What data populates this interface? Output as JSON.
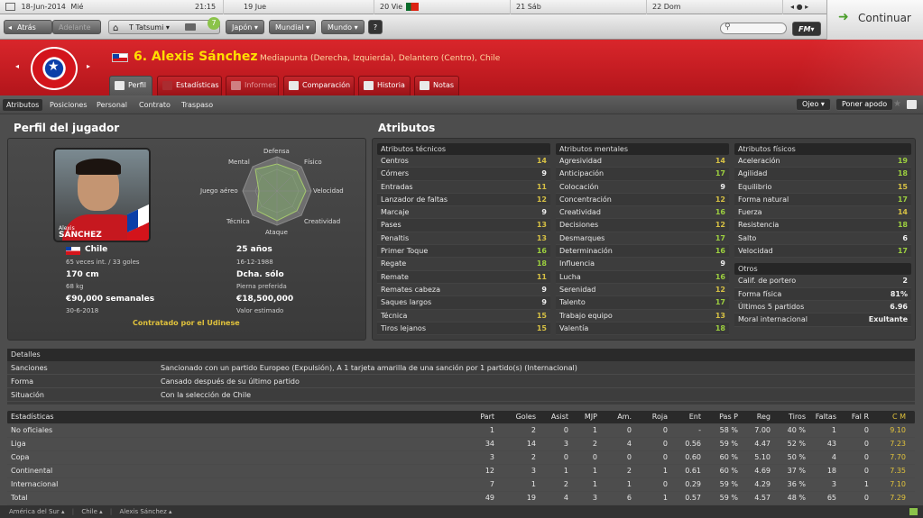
{
  "topstrip": {
    "date": "18-Jun-2014",
    "day": "Mié",
    "time": "21:15",
    "cal": [
      {
        "label": "19 Jue"
      },
      {
        "label": "20 Vie"
      },
      {
        "label": "21 Sáb"
      },
      {
        "label": "22 Dom"
      }
    ]
  },
  "nav": {
    "back": "Atrás",
    "forward": "Adelante",
    "team": "T Tatsumi",
    "japan": "Japón",
    "mundial": "Mundial",
    "mundo": "Mundo",
    "help": "?",
    "badge": "7",
    "fm": "FM",
    "continue": "Continuar"
  },
  "player": {
    "title": "6. Alexis Sánchez",
    "positions": "Mediapunta (Derecha, Izquierda), Delantero (Centro), Chile"
  },
  "tabs": [
    {
      "label": "Perfil"
    },
    {
      "label": "Estadísticas"
    },
    {
      "label": "Informes"
    },
    {
      "label": "Comparación"
    },
    {
      "label": "Historia"
    },
    {
      "label": "Notas"
    }
  ],
  "subnav": {
    "items": [
      {
        "label": "Atributos"
      },
      {
        "label": "Posiciones"
      },
      {
        "label": "Personal"
      },
      {
        "label": "Contrato"
      },
      {
        "label": "Traspaso"
      }
    ],
    "ojeo": "Ojeo",
    "poner_apodo": "Poner apodo"
  },
  "profile": {
    "heading": "Perfil del jugador",
    "radar": {
      "defensa": "Defensa",
      "fisico": "Físico",
      "velocidad": "Velocidad",
      "creatividad": "Creatividad",
      "ataque": "Ataque",
      "tecnica": "Técnica",
      "juego_aereo": "Juego aéreo",
      "mental": "Mental"
    },
    "photo_first": "Alexis",
    "photo_last": "SÁNCHEZ",
    "nation": "Chile",
    "caps": "65 veces int. / 33 goles",
    "age": "25 años",
    "dob": "16-12-1988",
    "height": "170 cm",
    "weight": "68 kg",
    "foot": "Dcha. sólo",
    "foot_label": "Pierna preferida",
    "wage": "€90,000 semanales",
    "contract_end": "30-6-2018",
    "value": "€18,500,000",
    "value_label": "Valor estimado",
    "status": "Contratado por el Udinese"
  },
  "attributes": {
    "heading": "Atributos",
    "technical": {
      "title": "Atributos técnicos",
      "rows": [
        {
          "name": "Centros",
          "value": "14"
        },
        {
          "name": "Córners",
          "value": "9"
        },
        {
          "name": "Entradas",
          "value": "11"
        },
        {
          "name": "Lanzador de faltas",
          "value": "12"
        },
        {
          "name": "Marcaje",
          "value": "9"
        },
        {
          "name": "Pases",
          "value": "13"
        },
        {
          "name": "Penaltis",
          "value": "13"
        },
        {
          "name": "Primer Toque",
          "value": "16"
        },
        {
          "name": "Regate",
          "value": "18"
        },
        {
          "name": "Remate",
          "value": "11"
        },
        {
          "name": "Remates cabeza",
          "value": "9"
        },
        {
          "name": "Saques largos",
          "value": "9"
        },
        {
          "name": "Técnica",
          "value": "15"
        },
        {
          "name": "Tiros lejanos",
          "value": "15"
        }
      ]
    },
    "mental": {
      "title": "Atributos mentales",
      "rows": [
        {
          "name": "Agresividad",
          "value": "14"
        },
        {
          "name": "Anticipación",
          "value": "17"
        },
        {
          "name": "Colocación",
          "value": "9"
        },
        {
          "name": "Concentración",
          "value": "12"
        },
        {
          "name": "Creatividad",
          "value": "16"
        },
        {
          "name": "Decisiones",
          "value": "12"
        },
        {
          "name": "Desmarques",
          "value": "17"
        },
        {
          "name": "Determinación",
          "value": "16"
        },
        {
          "name": "Influencia",
          "value": "9"
        },
        {
          "name": "Lucha",
          "value": "16"
        },
        {
          "name": "Serenidad",
          "value": "12"
        },
        {
          "name": "Talento",
          "value": "17"
        },
        {
          "name": "Trabajo equipo",
          "value": "13"
        },
        {
          "name": "Valentía",
          "value": "18"
        }
      ]
    },
    "physical": {
      "title": "Atributos físicos",
      "rows": [
        {
          "name": "Aceleración",
          "value": "19"
        },
        {
          "name": "Agilidad",
          "value": "18"
        },
        {
          "name": "Equilibrio",
          "value": "15"
        },
        {
          "name": "Forma natural",
          "value": "17"
        },
        {
          "name": "Fuerza",
          "value": "14"
        },
        {
          "name": "Resistencia",
          "value": "18"
        },
        {
          "name": "Salto",
          "value": "6"
        },
        {
          "name": "Velocidad",
          "value": "17"
        }
      ]
    },
    "other": {
      "title": "Otros",
      "rows": [
        {
          "name": "Calif. de portero",
          "value": "2"
        },
        {
          "name": "Forma física",
          "value": "81%"
        },
        {
          "name": "Últimos 5 partidos",
          "value": "6.96"
        },
        {
          "name": "Moral internacional",
          "value": "Exultante"
        }
      ]
    }
  },
  "details": {
    "title": "Detalles",
    "rows": [
      {
        "label": "Sanciones",
        "value": "Sancionado con un partido Europeo (Expulsión), A 1 tarjeta amarilla de una sanción por 1 partido(s) (Internacional)"
      },
      {
        "label": "Forma",
        "value": "Cansado después de su último partido"
      },
      {
        "label": "Situación",
        "value": "Con la selección de Chile"
      }
    ]
  },
  "stats": {
    "title": "Estadísticas",
    "headers": [
      "Part",
      "Goles",
      "Asist",
      "MJP",
      "Am.",
      "Roja",
      "Ent",
      "Pas P",
      "Reg",
      "Tiros",
      "Faltas",
      "Fal R",
      "C M"
    ],
    "rows": [
      {
        "label": "No oficiales",
        "values": [
          "1",
          "2",
          "0",
          "1",
          "0",
          "0",
          "-",
          "58 %",
          "7.00",
          "40 %",
          "1",
          "0",
          "9.10"
        ]
      },
      {
        "label": "Liga",
        "values": [
          "34",
          "14",
          "3",
          "2",
          "4",
          "0",
          "0.56",
          "59 %",
          "4.47",
          "52 %",
          "43",
          "0",
          "7.23"
        ]
      },
      {
        "label": "Copa",
        "values": [
          "3",
          "2",
          "0",
          "0",
          "0",
          "0",
          "0.60",
          "60 %",
          "5.10",
          "50 %",
          "4",
          "0",
          "7.70"
        ]
      },
      {
        "label": "Continental",
        "values": [
          "12",
          "3",
          "1",
          "1",
          "2",
          "1",
          "0.61",
          "60 %",
          "4.69",
          "37 %",
          "18",
          "0",
          "7.35"
        ]
      },
      {
        "label": "Internacional",
        "values": [
          "7",
          "1",
          "2",
          "1",
          "1",
          "0",
          "0.29",
          "59 %",
          "4.29",
          "36 %",
          "3",
          "1",
          "7.10"
        ]
      },
      {
        "label": "Total",
        "values": [
          "49",
          "19",
          "4",
          "3",
          "6",
          "1",
          "0.57",
          "59 %",
          "4.57",
          "48 %",
          "65",
          "0",
          "7.29"
        ]
      }
    ]
  },
  "breadcrumbs": [
    {
      "label": "América del Sur"
    },
    {
      "label": "Chile"
    },
    {
      "label": "Alexis Sánchez"
    }
  ],
  "colors": {
    "header_red": "#c81d23",
    "good": "#9ccf3f",
    "accent_yellow": "#e0c23c"
  }
}
